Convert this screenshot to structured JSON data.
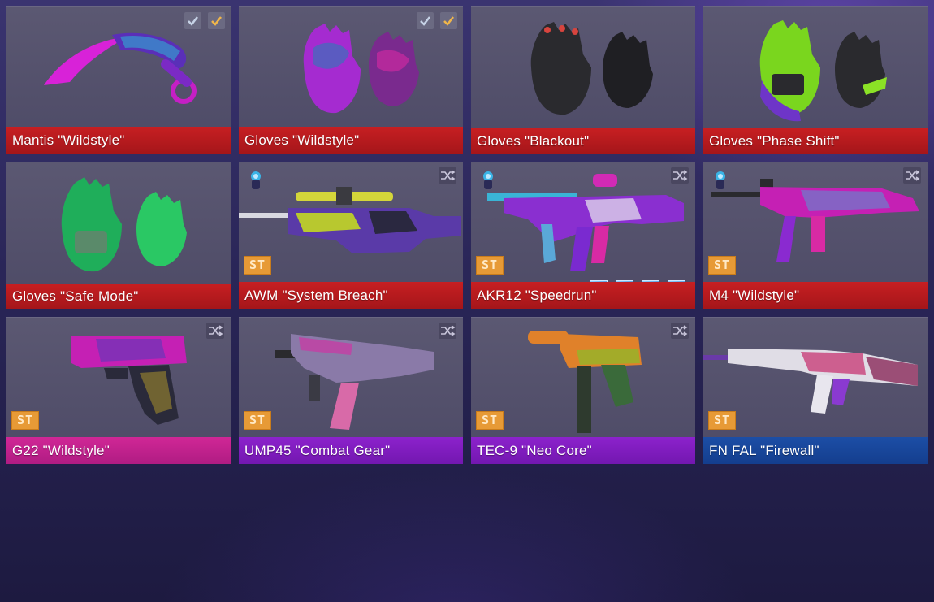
{
  "inventory": {
    "items": [
      {
        "name": "Mantis \"Wildstyle\"",
        "rarity_color": "#b31a1e",
        "checks": [
          "grey",
          "gold"
        ]
      },
      {
        "name": "Gloves \"Wildstyle\"",
        "rarity_color": "#b31a1e",
        "checks": [
          "grey",
          "gold"
        ]
      },
      {
        "name": "Gloves \"Blackout\"",
        "rarity_color": "#b31a1e"
      },
      {
        "name": "Gloves \"Phase Shift\"",
        "rarity_color": "#b31a1e"
      },
      {
        "name": "Gloves \"Safe Mode\"",
        "rarity_color": "#b31a1e"
      },
      {
        "name": "AWM \"System Breach\"",
        "rarity_color": "#b31a1e",
        "badge": "ST",
        "icons": [
          "sticker-icon",
          "shuffle-icon"
        ]
      },
      {
        "name": "AKR12 \"Speedrun\"",
        "rarity_color": "#b31a1e",
        "badge": "ST",
        "icons": [
          "sticker-icon",
          "shuffle-icon"
        ]
      },
      {
        "name": "M4 \"Wildstyle\"",
        "rarity_color": "#b31a1e",
        "badge": "ST",
        "icons": [
          "sticker-icon",
          "shuffle-icon"
        ]
      },
      {
        "name": "G22 \"Wildstyle\"",
        "rarity_color": "#c0218b",
        "badge": "ST",
        "icons": [
          "shuffle-icon"
        ]
      },
      {
        "name": "UMP45 \"Combat Gear\"",
        "rarity_color": "#7e1cbf",
        "badge": "ST",
        "icons": [
          "shuffle-icon"
        ]
      },
      {
        "name": "TEC-9 \"Neo Core\"",
        "rarity_color": "#7e1cbf",
        "badge": "ST",
        "icons": [
          "shuffle-icon"
        ]
      },
      {
        "name": "FN FAL \"Firewall\"",
        "rarity_color": "#17459a",
        "badge": "ST"
      }
    ]
  }
}
